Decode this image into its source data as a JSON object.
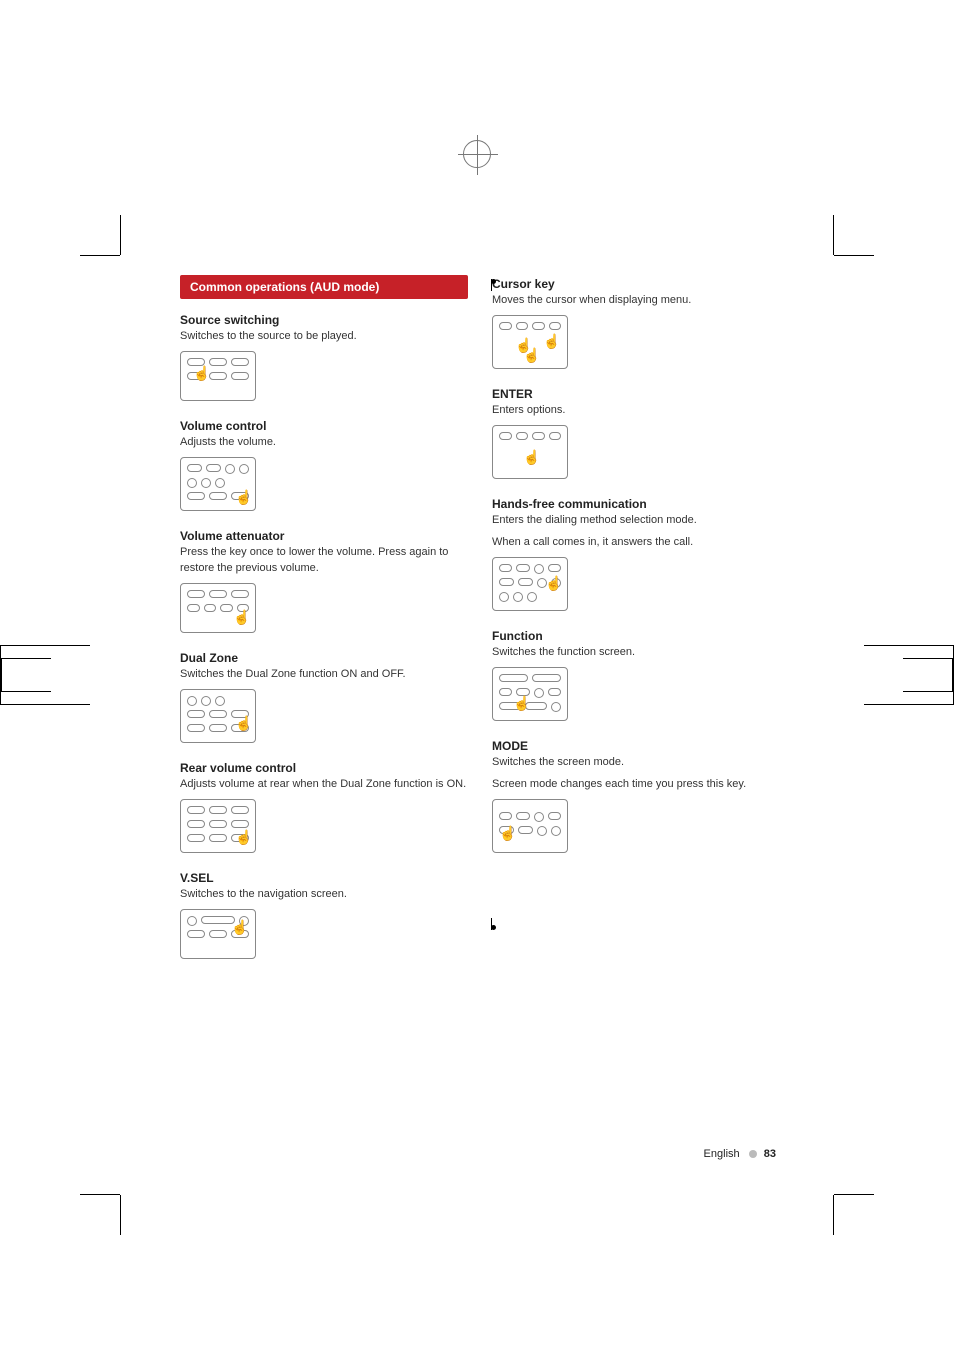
{
  "section_title": "Common operations (AUD mode)",
  "left": {
    "source_switching": {
      "title": "Source switching",
      "desc": "Switches to the source to be played."
    },
    "volume_control": {
      "title": "Volume control",
      "desc": "Adjusts the volume."
    },
    "volume_attenuator": {
      "title": "Volume attenuator",
      "desc": "Press the key once to lower the volume. Press again to restore the previous volume."
    },
    "dual_zone": {
      "title": "Dual Zone",
      "desc": "Switches the Dual Zone function ON and OFF."
    },
    "rear_volume": {
      "title": "Rear volume control",
      "desc": "Adjusts volume at rear when the Dual Zone function is ON."
    },
    "vsel": {
      "title": "V.SEL",
      "desc": "Switches to the navigation screen."
    }
  },
  "right": {
    "cursor_key": {
      "title": "Cursor key",
      "desc": "Moves the cursor when displaying menu."
    },
    "enter": {
      "title": "ENTER",
      "desc": "Enters options."
    },
    "hands_free": {
      "title": "Hands-free communication",
      "desc1": "Enters the dialing method selection mode.",
      "desc2": "When a call comes in, it answers the call."
    },
    "function": {
      "title": "Function",
      "desc": "Switches the function screen."
    },
    "mode": {
      "title": "MODE",
      "desc1": "Switches the screen mode.",
      "desc2": "Screen mode changes each time you press this key."
    }
  },
  "footer": {
    "lang": "English",
    "page": "83"
  }
}
